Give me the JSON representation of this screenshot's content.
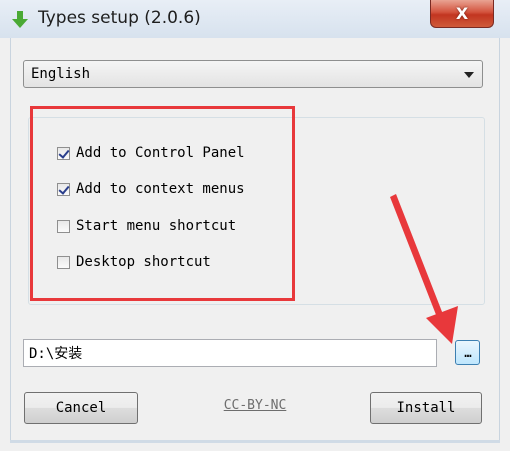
{
  "window": {
    "title": "Types setup (2.0.6)",
    "close_label": "X"
  },
  "language": {
    "selected": "English"
  },
  "options": [
    {
      "label": "Add to Control Panel",
      "checked": true
    },
    {
      "label": "Add to context menus",
      "checked": true
    },
    {
      "label": "Start menu shortcut",
      "checked": false
    },
    {
      "label": "Desktop shortcut",
      "checked": false
    }
  ],
  "install_path": {
    "value": "D:\\安装",
    "browse_label": "…"
  },
  "buttons": {
    "cancel": "Cancel",
    "install": "Install"
  },
  "license_link": "CC-BY-NC",
  "colors": {
    "annotation": "#e8383b",
    "title_icon": "#4aa934"
  }
}
